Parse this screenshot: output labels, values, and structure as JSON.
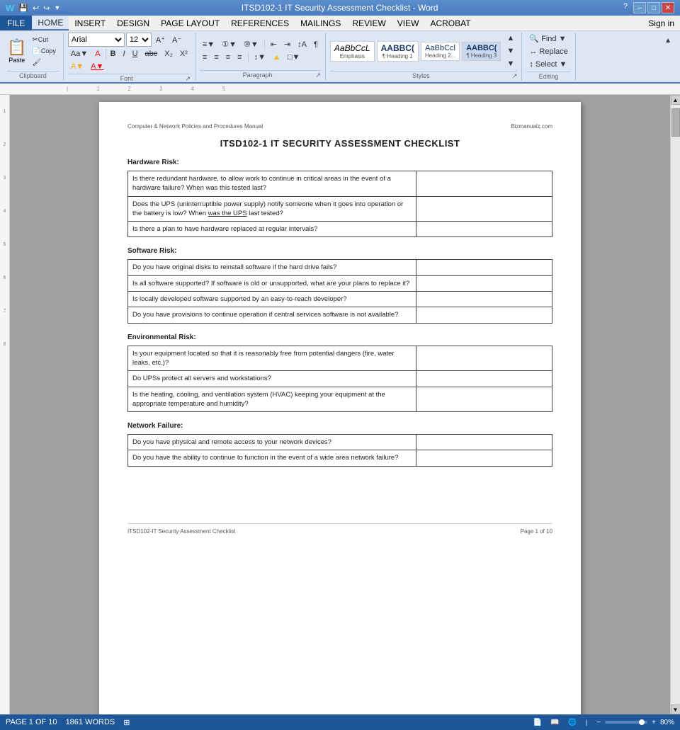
{
  "titlebar": {
    "title": "ITSD102-1 IT Security Assessment Checklist - Word",
    "minimize": "–",
    "maximize": "□",
    "close": "✕"
  },
  "menubar": {
    "items": [
      "FILE",
      "HOME",
      "INSERT",
      "DESIGN",
      "PAGE LAYOUT",
      "REFERENCES",
      "MAILINGS",
      "REVIEW",
      "VIEW",
      "ACROBAT"
    ],
    "active": "HOME",
    "signin": "Sign in"
  },
  "ribbon": {
    "clipboard_label": "Clipboard",
    "font_label": "Font",
    "paragraph_label": "Paragraph",
    "styles_label": "Styles",
    "editing_label": "Editing",
    "font_name": "Arial",
    "font_size": "12",
    "paste_label": "Paste",
    "cut_label": "Cut",
    "copy_label": "Copy",
    "format_painter_label": "Format Painter",
    "bold": "B",
    "italic": "I",
    "underline": "U",
    "strikethrough": "abc",
    "subscript": "X₂",
    "superscript": "X²",
    "find_label": "Find",
    "replace_label": "Replace",
    "select_label": "Select",
    "styles": [
      {
        "label": "AaBbCcL",
        "name": "Emphasis",
        "class": "emphasis"
      },
      {
        "label": "AABBC(",
        "name": "Heading 1",
        "class": "heading1"
      },
      {
        "label": "AaBbCcl",
        "name": "Heading 2",
        "class": "heading2"
      },
      {
        "label": "AABBC(",
        "name": "Heading 3",
        "class": "heading3"
      }
    ]
  },
  "document": {
    "header_left": "Computer & Network Policies and Procedures Manual",
    "header_right": "Bizmanualz.com",
    "title": "ITSD102-1   IT SECURITY ASSESSMENT CHECKLIST",
    "sections": [
      {
        "heading": "Hardware Risk:",
        "rows": [
          {
            "question": "Is there redundant hardware, to allow work to continue in critical areas in the event of a hardware failure?  When was this tested last?",
            "answer": ""
          },
          {
            "question": "Does the UPS (uninterruptible power supply) notify someone when it goes into operation or the battery is low? When was the UPS last tested?",
            "answer": "",
            "underline": "was the UPS"
          },
          {
            "question": "Is there a plan to have hardware replaced at regular intervals?",
            "answer": ""
          }
        ]
      },
      {
        "heading": "Software Risk:",
        "rows": [
          {
            "question": "Do you have original disks to reinstall software if the hard drive fails?",
            "answer": ""
          },
          {
            "question": "Is all software supported?  If software is old or unsupported, what are your plans to replace it?",
            "answer": ""
          },
          {
            "question": "Is locally developed software supported by an easy-to-reach developer?",
            "answer": ""
          },
          {
            "question": "Do you have provisions to continue operation if central services software is not available?",
            "answer": ""
          }
        ]
      },
      {
        "heading": "Environmental Risk:",
        "rows": [
          {
            "question": "Is your equipment located so that it is reasonably free from potential dangers (fire, water leaks, etc.)?",
            "answer": ""
          },
          {
            "question": "Do UPSs protect all servers and workstations?",
            "answer": ""
          },
          {
            "question": "Is the heating, cooling, and ventilation system (HVAC) keeping your equipment at the appropriate temperature and humidity?",
            "answer": ""
          }
        ]
      },
      {
        "heading": "Network Failure:",
        "rows": [
          {
            "question": "Do you have physical and remote access to your network devices?",
            "answer": ""
          },
          {
            "question": "Do you have the ability to continue to function in the event of a wide area network failure?",
            "answer": ""
          }
        ]
      }
    ],
    "footer_left": "ITSD102-IT Security Assessment Checklist",
    "footer_right": "Page 1 of 10"
  },
  "statusbar": {
    "page_info": "PAGE 1 OF 10",
    "word_count": "1861 WORDS",
    "zoom_level": "80%",
    "layout_icon": "⊞"
  }
}
